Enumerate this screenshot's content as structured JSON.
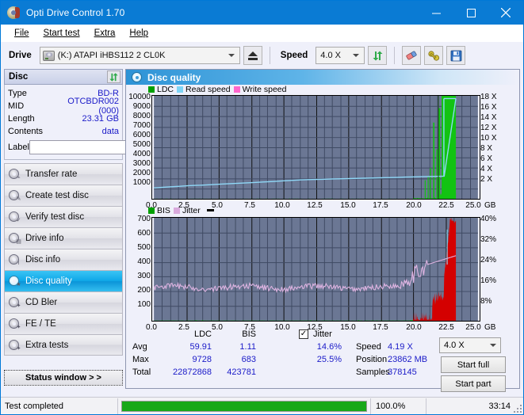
{
  "window": {
    "title": "Opti Drive Control 1.70",
    "icon": "disc-icon",
    "minimize": "minimize",
    "maximize": "maximize",
    "close": "close"
  },
  "menu": [
    {
      "label": "File",
      "accel": "F"
    },
    {
      "label": "Start test",
      "accel": "S"
    },
    {
      "label": "Extra",
      "accel": "x"
    },
    {
      "label": "Help",
      "accel": "H"
    }
  ],
  "toolbar": {
    "drive_label": "Drive",
    "drive_value": "(K:)  ATAPI iHBS112  2 CL0K",
    "eject_name": "eject-button",
    "speed_label": "Speed",
    "speed_value": "4.0 X",
    "refresh_name": "refresh-button",
    "erase_name": "erase-button",
    "tools_name": "tools-button",
    "save_name": "save-button"
  },
  "disc_panel": {
    "title": "Disc",
    "refresh_name": "disc-refresh-button",
    "rows": [
      {
        "key": "Type",
        "value": "BD-R"
      },
      {
        "key": "MID",
        "value": "OTCBDR002 (000)"
      },
      {
        "key": "Length",
        "value": "23.31 GB"
      },
      {
        "key": "Contents",
        "value": "data"
      }
    ],
    "label_key": "Label",
    "label_value": "",
    "label_placeholder": ""
  },
  "nav": {
    "items": [
      {
        "label": "Transfer rate",
        "active": false
      },
      {
        "label": "Create test disc",
        "active": false
      },
      {
        "label": "Verify test disc",
        "active": false
      },
      {
        "label": "Drive info",
        "active": false
      },
      {
        "label": "Disc info",
        "active": false
      },
      {
        "label": "Disc quality",
        "active": true
      },
      {
        "label": "CD Bler",
        "active": false
      },
      {
        "label": "FE / TE",
        "active": false
      },
      {
        "label": "Extra tests",
        "active": false
      }
    ],
    "status_window": "Status window > >"
  },
  "main": {
    "header": "Disc quality",
    "header_icon": "disc-quality-icon"
  },
  "chart_data": [
    {
      "type": "line",
      "name": "top-chart",
      "title": "",
      "legend": [
        {
          "label": "LDC",
          "color": "#00a000"
        },
        {
          "label": "Read speed",
          "color": "#7fd4f5"
        },
        {
          "label": "Write speed",
          "color": "#ff66cc"
        }
      ],
      "legend_position": "top-left",
      "grid": true,
      "xlabel": "GB",
      "x_ticks": [
        "0.0",
        "2.5",
        "5.0",
        "7.5",
        "10.0",
        "12.5",
        "15.0",
        "17.5",
        "20.0",
        "22.5",
        "25.0"
      ],
      "xlim": [
        0,
        25
      ],
      "ylabel_left": "LDC",
      "y_ticks_left": [
        "10000",
        "9000",
        "8000",
        "7000",
        "6000",
        "5000",
        "4000",
        "3000",
        "2000",
        "1000"
      ],
      "ylim_left": [
        0,
        10000
      ],
      "ylabel_right": "Speed",
      "y_ticks_right": [
        "18 X",
        "16 X",
        "14 X",
        "12 X",
        "10 X",
        "8 X",
        "6 X",
        "4 X",
        "2 X"
      ],
      "ylim_right": [
        0,
        19
      ],
      "series": [
        {
          "name": "Read speed",
          "color": "#7fd4f5",
          "unit": "X",
          "x": [
            0.0,
            0.6,
            1.2,
            2.0,
            2.8,
            3.6,
            4.4,
            5.2,
            6.0,
            6.8,
            7.6,
            8.4,
            9.2,
            9.9,
            10.6,
            11.4,
            12.2,
            13.0,
            13.8,
            14.6,
            15.4,
            16.2,
            17.0,
            17.8,
            18.6,
            19.4,
            20.2,
            21.0,
            21.8,
            22.4,
            23.3
          ],
          "values": [
            2.0,
            2.1,
            2.2,
            2.3,
            2.45,
            2.5,
            2.6,
            2.7,
            2.8,
            2.9,
            3.0,
            3.1,
            3.2,
            3.3,
            3.4,
            3.5,
            3.55,
            3.6,
            3.65,
            3.7,
            3.75,
            3.8,
            3.85,
            3.9,
            3.95,
            4.0,
            4.05,
            4.1,
            4.15,
            4.18,
            18.5
          ]
        },
        {
          "name": "LDC",
          "color": "#00c000",
          "unit": "errors",
          "note": "low baseline across disc, large green block spike near 22.3-23.3 GB reaching top of scale"
        }
      ]
    },
    {
      "type": "line",
      "name": "bottom-chart",
      "title": "",
      "legend": [
        {
          "label": "BIS",
          "color": "#00a000"
        },
        {
          "label": "Jitter",
          "color": "#d9aadd"
        }
      ],
      "legend_position": "top-left",
      "grid": true,
      "xlabel": "GB",
      "x_ticks": [
        "0.0",
        "2.5",
        "5.0",
        "7.5",
        "10.0",
        "12.5",
        "15.0",
        "17.5",
        "20.0",
        "22.5",
        "25.0"
      ],
      "xlim": [
        0,
        25
      ],
      "ylabel_left": "BIS",
      "y_ticks_left": [
        "700",
        "600",
        "500",
        "400",
        "300",
        "200",
        "100"
      ],
      "ylim_left": [
        0,
        700
      ],
      "ylabel_right": "Jitter",
      "y_ticks_right": [
        "40%",
        "32%",
        "24%",
        "16%",
        "8%"
      ],
      "ylim_right": [
        0,
        44
      ],
      "series": [
        {
          "name": "Jitter",
          "color": "#d9aadd",
          "unit": "%",
          "note": "noisy band centered near 14-15% across the disc, rising to ~24% near 21-22.5 GB, peaks near 38% at 23 GB"
        },
        {
          "name": "BIS",
          "color": "#00a000",
          "unit": "errors",
          "note": "near-zero baseline, red spike near 22.5-23.3 GB reaching about 680"
        }
      ]
    }
  ],
  "stats": {
    "col_headers": [
      "LDC",
      "BIS"
    ],
    "rows": [
      {
        "label": "Avg",
        "ldc": "59.91",
        "bis": "1.11"
      },
      {
        "label": "Max",
        "ldc": "9728",
        "bis": "683"
      },
      {
        "label": "Total",
        "ldc": "22872868",
        "bis": "423781"
      }
    ],
    "jitter": {
      "checkbox_label": "Jitter",
      "checked": true,
      "avg": "14.6%",
      "max": "25.5%"
    },
    "info": [
      {
        "label": "Speed",
        "value": "4.19 X"
      },
      {
        "label": "Position",
        "value": "23862 MB"
      },
      {
        "label": "Samples",
        "value": "378145"
      }
    ],
    "speed_select": "4.0 X",
    "start_full": "Start full",
    "start_part": "Start part"
  },
  "statusbar": {
    "message": "Test completed",
    "progress_percent": 100,
    "progress_text": "100.0%",
    "elapsed": "33:14"
  },
  "colors": {
    "accent": "#0a7bd4",
    "plot_bg": "#6b7794",
    "ldc_green": "#00c000",
    "read_speed": "#7fd4f5",
    "write_speed": "#ff66cc",
    "jitter_pink": "#d9aadd",
    "bis_red": "#cc0000",
    "value_blue": "#1a1ac8",
    "progress_green": "#18a818"
  }
}
